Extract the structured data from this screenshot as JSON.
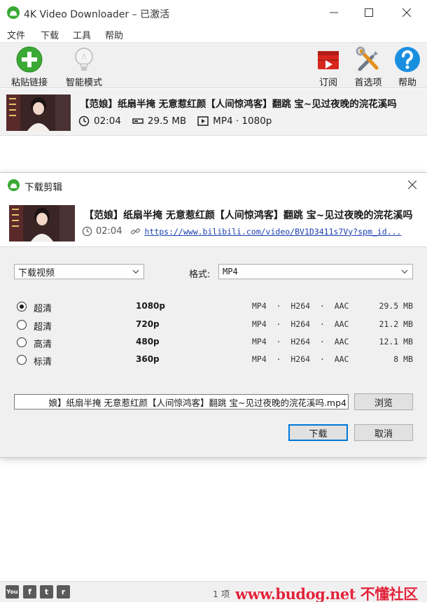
{
  "window": {
    "title": "4K Video Downloader – 已激活"
  },
  "menu": [
    "文件",
    "下载",
    "工具",
    "帮助"
  ],
  "toolbar": {
    "paste_link": "粘贴链接",
    "smart_mode": "智能模式",
    "subscribe": "订阅",
    "preferences": "首选项",
    "help": "帮助"
  },
  "download_item": {
    "title": "【范娘】纸扇半掩 无意惹红颜【人间惊鸿客】翻跳 宝~见过夜晚的浣花溪吗",
    "duration": "02:04",
    "size": "29.5 MB",
    "format": "MP4 · 1080p"
  },
  "dialog": {
    "title": "下载剪辑",
    "video_title": "【范娘】纸扇半掩 无意惹红颜【人间惊鸿客】翻跳 宝~见过夜晚的浣花溪吗",
    "duration": "02:04",
    "url": "https://www.bilibili.com/video/BV1D3411s7Vy?spm_id...",
    "download_type": "下载视频",
    "format_label": "格式:",
    "format_value": "MP4",
    "options": [
      {
        "quality": "超清",
        "resolution": "1080p",
        "codec": "MP4  ·  H264  ·  AAC",
        "size": "29.5 MB",
        "selected": true
      },
      {
        "quality": "超清",
        "resolution": "720p",
        "codec": "MP4  ·  H264  ·  AAC",
        "size": "21.2 MB",
        "selected": false
      },
      {
        "quality": "高清",
        "resolution": "480p",
        "codec": "MP4  ·  H264  ·  AAC",
        "size": "12.1 MB",
        "selected": false
      },
      {
        "quality": "标清",
        "resolution": "360p",
        "codec": "MP4  ·  H264  ·  AAC",
        "size": "8 MB",
        "selected": false
      }
    ],
    "save_path": "娘】纸扇半掩 无意惹红颜【人间惊鸿客】翻跳 宝~见过夜晚的浣花溪吗.mp4",
    "browse": "浏览",
    "download": "下载",
    "cancel": "取消"
  },
  "statusbar": {
    "count": "1 项",
    "watermark": "www.budog.net 不懂社区"
  },
  "colors": {
    "accent": "#0078d7",
    "paste_green": "#3aa935",
    "help_blue": "#1a8fe0",
    "subscribe_red": "#d7271d",
    "watermark_red": "#e0243a"
  },
  "icons": {
    "app": "app-logo-icon",
    "paste": "plus-circle-icon",
    "smart": "lightbulb-icon",
    "subscribe": "youtube-subscribe-icon",
    "preferences": "tools-icon",
    "help": "question-circle-icon",
    "clock": "clock-icon",
    "filesize": "filesize-icon",
    "format": "video-format-icon",
    "link": "link-icon"
  }
}
